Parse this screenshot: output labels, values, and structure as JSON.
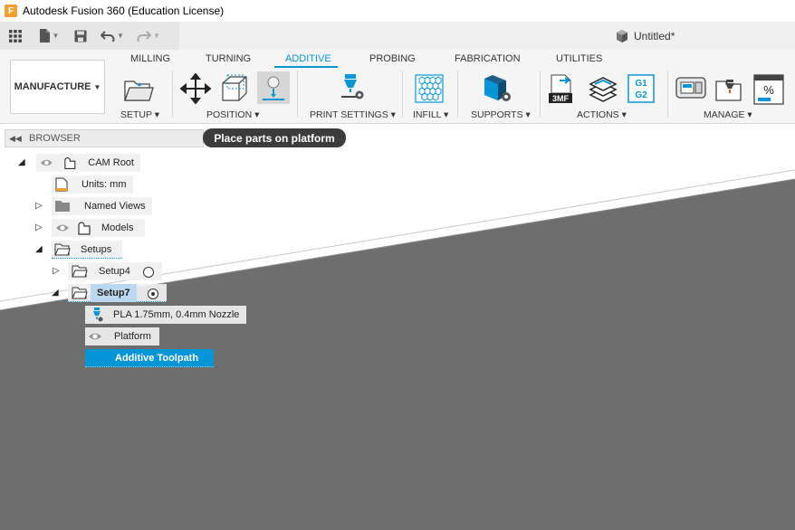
{
  "app": {
    "title": "Autodesk Fusion 360 (Education License)",
    "icon_letter": "F"
  },
  "document": {
    "name": "Untitled*"
  },
  "workspace": {
    "label": "MANUFACTURE"
  },
  "tabs": [
    {
      "label": "MILLING",
      "active": false
    },
    {
      "label": "TURNING",
      "active": false
    },
    {
      "label": "ADDITIVE",
      "active": true
    },
    {
      "label": "PROBING",
      "active": false
    },
    {
      "label": "FABRICATION",
      "active": false
    },
    {
      "label": "UTILITIES",
      "active": false
    }
  ],
  "panels": {
    "setup": "SETUP",
    "position": "POSITION",
    "print_settings": "PRINT SETTINGS",
    "infill": "INFILL",
    "supports": "SUPPORTS",
    "actions": "ACTIONS",
    "manage": "MANAGE"
  },
  "tool_text": {
    "threemf": "3MF",
    "g1": "G1",
    "g2": "G2",
    "percent": "%"
  },
  "browser": {
    "title": "BROWSER",
    "tooltip": "Place parts on platform",
    "nodes": {
      "cam_root": "CAM Root",
      "units": "Units: mm",
      "named_views": "Named Views",
      "models": "Models",
      "setups": "Setups",
      "setup4": "Setup4",
      "setup7": "Setup7",
      "print_setting": "PLA 1.75mm, 0.4mm Nozzle",
      "platform": "Platform",
      "toolpath": "Additive Toolpath"
    }
  },
  "colors": {
    "accent": "#0696d7",
    "plane": "#6e6e6e",
    "tooltip_bg": "#3c3c3c"
  }
}
